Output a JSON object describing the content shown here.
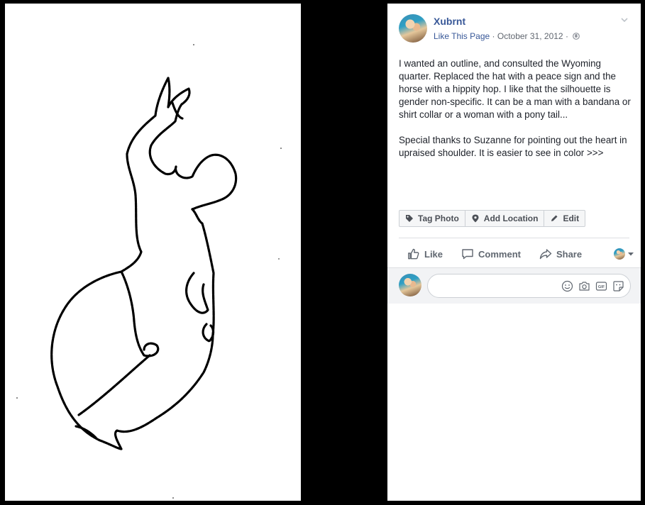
{
  "photo": {
    "description_icon": "sketch-drawing"
  },
  "post": {
    "page_name": "Xubrnt",
    "like_link": "Like This Page",
    "separator": "·",
    "date": "October 31, 2012",
    "audience_icon": "globe-icon",
    "text_paragraphs": [
      "I wanted an outline, and consulted the Wyoming quarter. Replaced the hat with a peace sign and the horse with a hippity hop. I like that the silhouette is gender non-specific. It can be a man with a bandana or shirt collar or a woman with a pony tail...",
      "Special thanks to Suzanne for pointing out the heart in upraised shoulder. It is easier to see in color >>>"
    ]
  },
  "photo_actions": {
    "tag": {
      "label": "Tag Photo",
      "icon": "tag-icon"
    },
    "location": {
      "label": "Add Location",
      "icon": "location-pin-icon"
    },
    "edit": {
      "label": "Edit",
      "icon": "pencil-icon"
    }
  },
  "reactions": {
    "like": {
      "label": "Like",
      "icon": "thumbs-up-icon"
    },
    "comment": {
      "label": "Comment",
      "icon": "comment-bubble-icon"
    },
    "share": {
      "label": "Share",
      "icon": "share-arrow-icon"
    }
  },
  "comment_box": {
    "placeholder": "",
    "icons": [
      "emoji-icon",
      "camera-icon",
      "gif-icon",
      "sticker-icon"
    ]
  },
  "colors": {
    "link_blue": "#385898",
    "text": "#1d2129",
    "secondary_text": "#616770",
    "action_text": "#606770",
    "background": "#000000"
  }
}
